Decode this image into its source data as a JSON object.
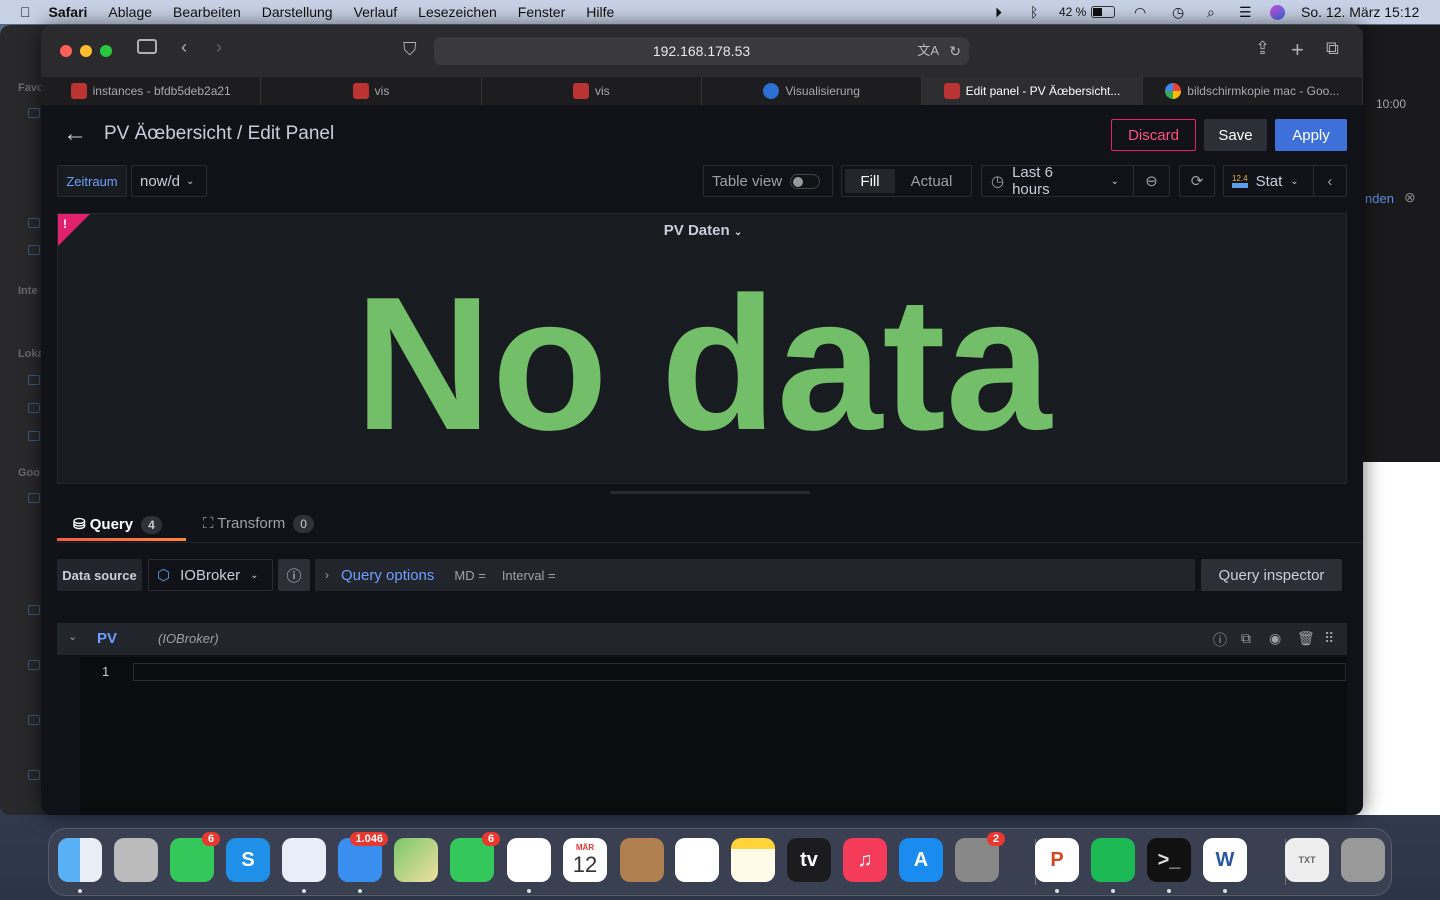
{
  "menubar": {
    "apple": "",
    "app": "Safari",
    "items": [
      "Ablage",
      "Bearbeiten",
      "Darstellung",
      "Verlauf",
      "Lesezeichen",
      "Fenster",
      "Hilfe"
    ],
    "battery": "42 %",
    "datetime": "So. 12. März  15:12"
  },
  "background_window": {
    "sidebar_labels": [
      "Favo",
      "Inte",
      "Loka",
      "Goo"
    ],
    "time": "10:00",
    "link": "nden"
  },
  "browser": {
    "url": "192.168.178.53",
    "tabs": [
      {
        "label": "instances - bfdb5deb2a21",
        "icon": "iobroker"
      },
      {
        "label": "vis",
        "icon": "iobroker"
      },
      {
        "label": "vis",
        "icon": "iobroker"
      },
      {
        "label": "Visualisierung",
        "icon": "info"
      },
      {
        "label": "Edit panel - PV Äœbersicht...",
        "icon": "iobroker",
        "active": true
      },
      {
        "label": "bildschirmkopie mac - Goo...",
        "icon": "google"
      }
    ]
  },
  "header": {
    "title": "PV Äœbersicht / Edit Panel",
    "discard": "Discard",
    "save": "Save",
    "apply": "Apply"
  },
  "controls": {
    "variable_label": "Zeitraum",
    "variable_value": "now/d",
    "table_view": "Table view",
    "table_view_on": false,
    "fill": "Fill",
    "actual": "Actual",
    "time_range": "Last 6 hours",
    "viz_icon_text": "12.4",
    "viz": "Stat"
  },
  "panel": {
    "title": "PV Daten",
    "message": "No data",
    "error_flag": "!",
    "value_color": "#73bf69"
  },
  "query_tabs": [
    {
      "label": "Query",
      "count": "4"
    },
    {
      "label": "Transform",
      "count": "0"
    }
  ],
  "query_bar": {
    "data_source_label": "Data source",
    "data_source": "IOBroker",
    "query_options": "Query options",
    "md": "MD =",
    "interval": "Interval =",
    "inspector": "Query inspector"
  },
  "query": {
    "ref": "PV",
    "datasource": "(IOBroker)",
    "line_number": "1",
    "value": ""
  },
  "dock": [
    {
      "app": "Finder"
    },
    {
      "app": "Launchpad"
    },
    {
      "app": "Messages",
      "badge": "6"
    },
    {
      "app": "Skype",
      "glyph": "S"
    },
    {
      "app": "Safari"
    },
    {
      "app": "Mail",
      "badge": "1.046"
    },
    {
      "app": "Maps"
    },
    {
      "app": "FaceTime",
      "badge": "6"
    },
    {
      "app": "Photos"
    },
    {
      "app": "Calendar",
      "month": "MÄR",
      "day": "12"
    },
    {
      "app": "Contacts"
    },
    {
      "app": "Reminders"
    },
    {
      "app": "Notes"
    },
    {
      "app": "TV",
      "glyph": "tv"
    },
    {
      "app": "Music",
      "glyph": "♫"
    },
    {
      "app": "App Store",
      "glyph": "A"
    },
    {
      "app": "System Settings",
      "badge": "2"
    },
    {
      "app": "PowerPoint",
      "glyph": "P"
    },
    {
      "app": "Spotify"
    },
    {
      "app": "Terminal",
      "glyph": ">_"
    },
    {
      "app": "Word",
      "glyph": "W"
    },
    {
      "app": "Document",
      "glyph": "TXT"
    },
    {
      "app": "Trash"
    }
  ]
}
